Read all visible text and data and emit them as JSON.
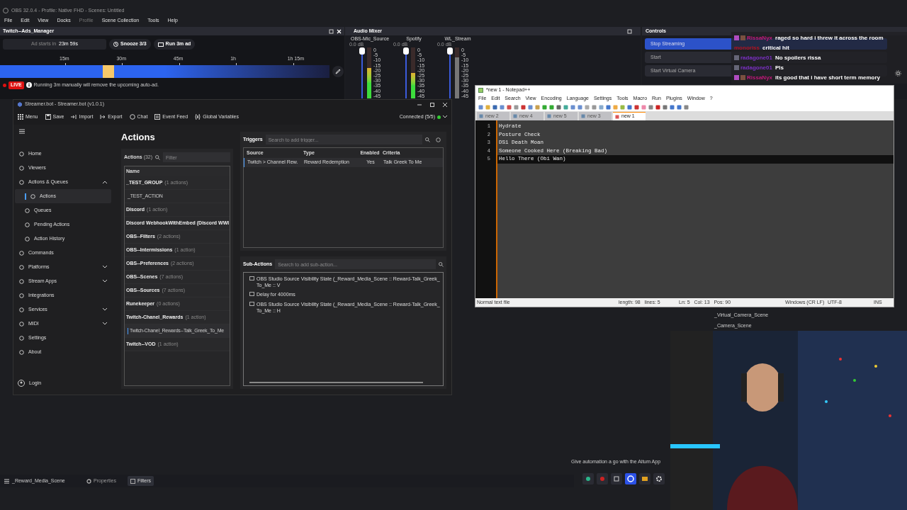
{
  "obs": {
    "title": "OBS 32.0.4 - Profile: Native FHD - Scenes: Untitled",
    "menu": [
      {
        "label": "File",
        "disabled": false
      },
      {
        "label": "Edit",
        "disabled": false
      },
      {
        "label": "View",
        "disabled": false
      },
      {
        "label": "Docks",
        "disabled": false
      },
      {
        "label": "Profile",
        "disabled": true
      },
      {
        "label": "Scene Collection",
        "disabled": false
      },
      {
        "label": "Tools",
        "disabled": false
      },
      {
        "label": "Help",
        "disabled": false
      }
    ],
    "ads_manager": {
      "title": "Twitch--Ads_Manager",
      "countdown_label": "Ad starts in",
      "countdown": "23m 59s",
      "snooze": "Snooze 3/3",
      "run": "Run 3m ad",
      "ticks": [
        "15m",
        "30m",
        "45m",
        "1h",
        "1h 15m"
      ],
      "live_badge": "LIVE",
      "notice": "Running 3m manually will remove the upcoming auto-ad."
    },
    "audio_mixer": {
      "title": "Audio Mixer",
      "channels": [
        {
          "name": "OBS-Mic_Source",
          "reading": "0.0 dB",
          "muted": false,
          "fader": {
            "level": 1
          },
          "meter": {
            "level": 0.6
          },
          "scale": [
            "0",
            "-5",
            "-10",
            "-15",
            "-20",
            "-25",
            "-30",
            "-35",
            "-40",
            "-45"
          ]
        },
        {
          "name": "Spotify",
          "reading": "0.0 dB",
          "muted": false,
          "fader": {
            "level": 1
          },
          "meter": {
            "level": 0.5
          },
          "scale": [
            "0",
            "-5",
            "-10",
            "-15",
            "-20",
            "-25",
            "-30",
            "-35",
            "-40",
            "-45"
          ]
        },
        {
          "name": "WL_Stream",
          "reading": "0.0 dB",
          "muted": true,
          "fader": {
            "level": 1
          },
          "meter": {
            "level": 0.8
          },
          "scale": [
            "0",
            "-5",
            "-10",
            "-15",
            "-20",
            "-25",
            "-30",
            "-35",
            "-40",
            "-45"
          ]
        }
      ]
    },
    "controls": {
      "title": "Controls",
      "buttons": [
        {
          "label": "Stop Streaming",
          "active": true
        },
        {
          "label": "Start",
          "active": false
        },
        {
          "label": "Start Virtual Camera",
          "active": false
        }
      ]
    },
    "scenes": [
      "_Virtual_Camera_Scene",
      "_Camera_Scene"
    ],
    "plugin_notice": "Give automation a go with the Aitum App",
    "bottom_bar": {
      "scene": "_Reward_Media_Scene",
      "tabs": [
        {
          "label": "Properties",
          "selected": false
        },
        {
          "label": "Filters",
          "selected": true
        }
      ]
    }
  },
  "chat": [
    {
      "user": "RissaNyx",
      "color": "#c21a7a",
      "badges": [
        {
          "kind": "subscriber"
        },
        {
          "kind": "sword"
        }
      ],
      "text": "raged so hard i threw it across the room"
    },
    {
      "user": "monoriss",
      "color": "#b3121d",
      "text": "critical hit"
    },
    {
      "user": "radagone01",
      "color": "#7a2fc2",
      "badges": [
        {
          "kind": "bottle"
        }
      ],
      "text": "No spoilers rissa"
    },
    {
      "user": "radagone01",
      "color": "#7a2fc2",
      "badges": [
        {
          "kind": "bottle"
        }
      ],
      "text": "Pls"
    },
    {
      "user": "RissaNyx",
      "color": "#c21a7a",
      "badges": [
        {
          "kind": "subscriber"
        },
        {
          "kind": "sword"
        }
      ],
      "text": "its good that i have short term memory"
    }
  ],
  "streamerbot": {
    "title": "Streamer.bot - Streamer.bot (v1.0.1)",
    "toolbar": [
      {
        "label": "Menu",
        "kind": "menu"
      },
      {
        "label": "Save",
        "kind": "save"
      },
      {
        "label": "Import",
        "kind": "import"
      },
      {
        "label": "Export",
        "kind": "export"
      },
      {
        "label": "Chat",
        "kind": "chat"
      },
      {
        "label": "Event Feed",
        "kind": "feed"
      },
      {
        "label": "Global Variables",
        "kind": "variables"
      }
    ],
    "connection": "Connected (5/5)",
    "connected": true,
    "sidebar": [
      {
        "label": "Home",
        "kind": "link",
        "selected": false
      },
      {
        "label": "Viewers",
        "kind": "link",
        "selected": false
      },
      {
        "label": "Actions & Queues",
        "kind": "group",
        "expanded": true,
        "selected": false,
        "children": [
          {
            "label": "Actions",
            "selected": true
          },
          {
            "label": "Queues",
            "selected": false
          },
          {
            "label": "Pending Actions",
            "selected": false
          },
          {
            "label": "Action History",
            "selected": false
          }
        ]
      },
      {
        "label": "Commands",
        "kind": "link",
        "selected": false
      },
      {
        "label": "Platforms",
        "kind": "group",
        "expanded": false,
        "selected": false
      },
      {
        "label": "Stream Apps",
        "kind": "group",
        "expanded": false,
        "selected": false
      },
      {
        "label": "Integrations",
        "kind": "link",
        "selected": false
      },
      {
        "label": "Services",
        "kind": "group",
        "expanded": false,
        "selected": false
      },
      {
        "label": "MIDI",
        "kind": "group",
        "expanded": false,
        "selected": false
      },
      {
        "label": "Settings",
        "kind": "link",
        "selected": false
      },
      {
        "label": "About",
        "kind": "link",
        "selected": false
      }
    ],
    "login": "Login",
    "page_title": "Actions",
    "actions": {
      "label": "Actions",
      "count": "(32)",
      "filter_placeholder": "Filter",
      "column": "Name",
      "rows": [
        {
          "name": "_TEST_GROUP",
          "count": "(1 actions)",
          "kind": "group",
          "selected": false
        },
        {
          "name": "_TEST_ACTION",
          "kind": "action",
          "selected": false
        },
        {
          "name": "Discord",
          "count": "(1 action)",
          "kind": "group",
          "selected": false
        },
        {
          "name": "Discord WebhookWithEmbed (Discord WWI",
          "kind": "group",
          "selected": false
        },
        {
          "name": "OBS--Filters",
          "count": "(2 actions)",
          "kind": "group",
          "selected": false
        },
        {
          "name": "OBS--Intermissions",
          "count": "(1 action)",
          "kind": "group",
          "selected": false
        },
        {
          "name": "OBS--Preferences",
          "count": "(2 actions)",
          "kind": "group",
          "selected": false
        },
        {
          "name": "OBS--Scenes",
          "count": "(7 actions)",
          "kind": "group",
          "selected": false
        },
        {
          "name": "OBS--Sources",
          "count": "(7 actions)",
          "kind": "group",
          "selected": false
        },
        {
          "name": "Runekeeper",
          "count": "(0 actions)",
          "kind": "group",
          "selected": false
        },
        {
          "name": "Twitch-Chanel_Rewards",
          "count": "(1 action)",
          "kind": "group",
          "selected": false
        },
        {
          "name": "Twitch-Chanel_Rewards--Talk_Greek_To_Me",
          "kind": "action",
          "selected": true
        },
        {
          "name": "Twitch--VOD",
          "count": "(1 action)",
          "kind": "group",
          "selected": false
        }
      ]
    },
    "triggers": {
      "label": "Triggers",
      "placeholder": "Search to add trigger...",
      "columns": [
        "Source",
        "Type",
        "Enabled",
        "Criteria"
      ],
      "rows": [
        {
          "cells": [
            "Twitch > Channel Rew.",
            "Reward Redemption",
            "Yes",
            "Talk Greek To Me"
          ],
          "selected": true
        }
      ]
    },
    "sub_actions": {
      "label": "Sub-Actions",
      "placeholder": "Search to add sub-action...",
      "rows": [
        "OBS Studio Source Visibility State (_Reward_Media_Scene :: Reward-Talk_Greek_To_Me :: V",
        "Delay for 4000ms",
        "OBS Studio Source Visibility State (_Reward_Media_Scene :: Reward-Talk_Greek_To_Me :: H"
      ]
    }
  },
  "notepad": {
    "title": "*new 1 - Notepad++",
    "menu": [
      "File",
      "Edit",
      "Search",
      "View",
      "Encoding",
      "Language",
      "Settings",
      "Tools",
      "Macro",
      "Run",
      "Plugins",
      "Window",
      "?"
    ],
    "tabs": [
      {
        "label": "new 2",
        "selected": false
      },
      {
        "label": "new 4",
        "selected": false
      },
      {
        "label": "new 5",
        "selected": false
      },
      {
        "label": "new 3",
        "selected": false
      },
      {
        "label": "new 1",
        "selected": true
      }
    ],
    "lines": [
      {
        "number": "1",
        "text": "Hydrate",
        "current": false
      },
      {
        "number": "2",
        "text": "Posture Check",
        "current": false
      },
      {
        "number": "3",
        "text": "DS1 Death Moan",
        "current": false
      },
      {
        "number": "4",
        "text": "Someone Cooked Here (Breaking Bad)",
        "current": false
      },
      {
        "number": "5",
        "text": "Hello There (Obi Wan)",
        "current": true
      }
    ],
    "status": [
      "Normal text file",
      "length: 98   lines: 5",
      "Ln: 5   Col: 13   Pos: 90",
      "Windows (CR LF)",
      "UTF-8",
      "INS"
    ]
  }
}
